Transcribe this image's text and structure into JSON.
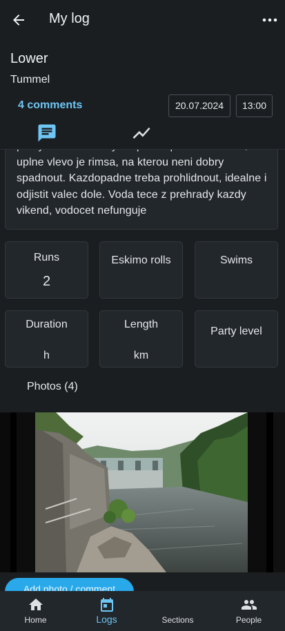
{
  "header": {
    "title": "My log",
    "section_name": "Lower",
    "river_name": "Tummel",
    "comments_label": "4 comments",
    "date": "20.07.2024",
    "time": "13:00"
  },
  "tabs": [
    {
      "icon": "comment-icon",
      "active": true
    },
    {
      "icon": "chart-line-icon",
      "active": false
    }
  ],
  "description": {
    "text": "pravy vracak. Ovsky drop ma vpravo autobout, uplne vlevo je rimsa, na kterou neni dobry spadnout. Kazdopadne treba prohlidnout, idealne i odjistit valec dole. Voda tece z prehrady kazdy vikend, vodocet nefunguje"
  },
  "stats": [
    {
      "label": "Runs",
      "value": "2"
    },
    {
      "label": "Eskimo rolls",
      "value": ""
    },
    {
      "label": "Swims",
      "value": ""
    },
    {
      "label": "Duration",
      "value": "h"
    },
    {
      "label": "Length",
      "value": "km"
    },
    {
      "label": "Party level",
      "value": ""
    }
  ],
  "photos": {
    "title": "Photos (4)",
    "add_button": "Add photo / comment"
  },
  "bottom_nav": [
    {
      "label": "Home",
      "icon": "home-icon"
    },
    {
      "label": "Logs",
      "icon": "calendar-icon",
      "active": true
    },
    {
      "label": "Sections",
      "icon": "sections-icon"
    },
    {
      "label": "People",
      "icon": "people-icon"
    }
  ],
  "colors": {
    "background": "#1b1e21",
    "card": "#22272b",
    "accent": "#29a9ea",
    "link": "#6ec6f5"
  }
}
